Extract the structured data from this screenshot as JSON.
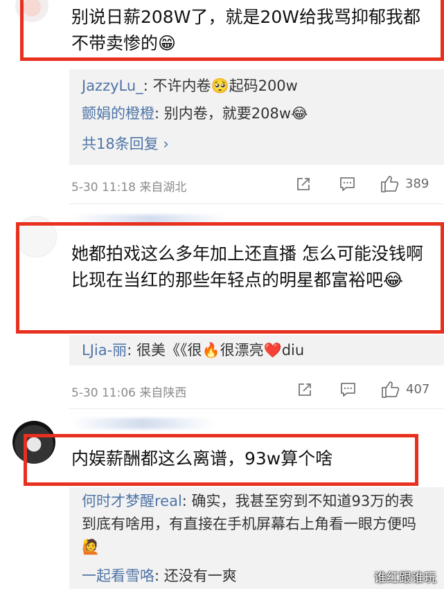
{
  "comments": [
    {
      "text": "别说日薪208W了，就是20W给我骂抑郁我都不带卖惨的😁",
      "replies": [
        {
          "name": "JazzyLu_",
          "text": ": 不许内卷🥺起码200w"
        },
        {
          "name": "颤娟的橙橙",
          "text": ": 别内卷，就要208w😂"
        }
      ],
      "more_replies": "共18条回复 ›",
      "time": "5-30 11:18",
      "location": "来自湖北",
      "likes": "389"
    },
    {
      "text": "她都拍戏这么多年加上还直播 怎么可能没钱啊 比现在当红的那些年轻点的明星都富裕吧😂",
      "replies": [
        {
          "name": "LJia-丽",
          "text": ": 很美《《很🔥很漂亮❤️diu"
        }
      ],
      "time": "5-30 11:06",
      "location": "来自陕西",
      "likes": "407"
    },
    {
      "text": "内娱薪酬都这么离谱，93w算个啥",
      "replies": [
        {
          "name": "何时才梦醒real",
          "text": ": 确实，我甚至穷到不知道93万的表到底有啥用，有直接在手机屏幕右上角看一眼方便吗🙋"
        },
        {
          "name": "一起看雪咯",
          "text": ": 还没有一爽"
        }
      ]
    }
  ],
  "watermark": "谁红跟谁玩",
  "colors": {
    "highlight": "#e8301f",
    "link": "#4e74a6",
    "meta": "#8a8a8a",
    "card": "#f2f2f2"
  },
  "icons": [
    "share-icon",
    "comment-icon",
    "like-icon"
  ]
}
